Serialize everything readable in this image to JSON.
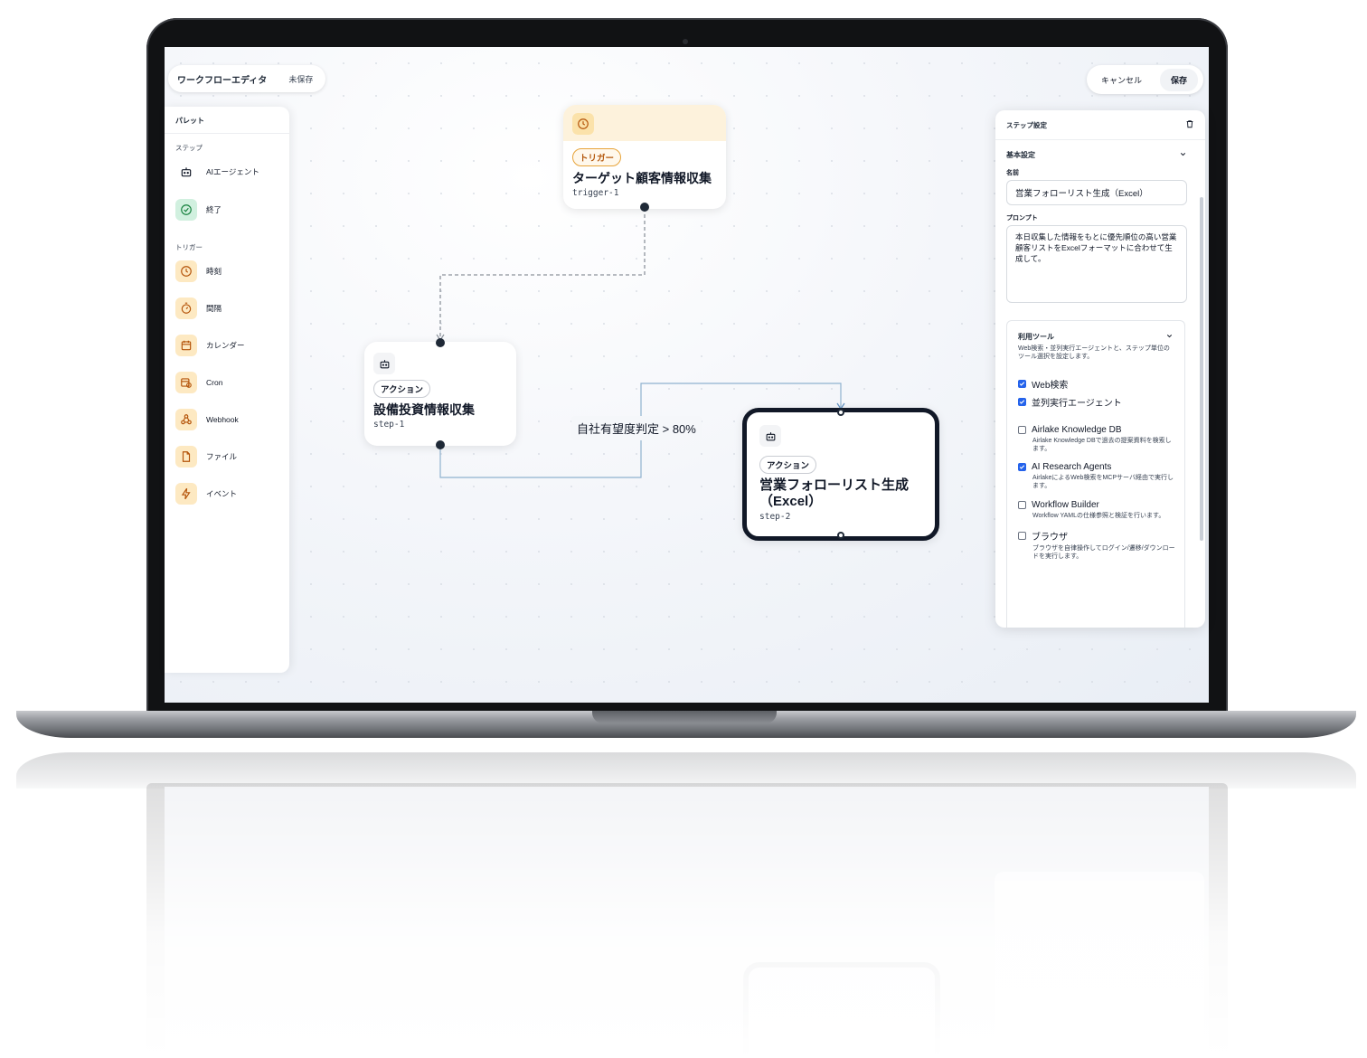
{
  "header": {
    "title": "ワークフローエディタ",
    "status": "未保存",
    "cancel_label": "キャンセル",
    "save_label": "保存"
  },
  "palette": {
    "title": "パレット",
    "steps_label": "ステップ",
    "steps": [
      {
        "label": "AIエージェント",
        "icon": "robot-icon"
      },
      {
        "label": "終了",
        "icon": "check-circle-icon"
      }
    ],
    "triggers_label": "トリガー",
    "triggers": [
      {
        "label": "時刻",
        "icon": "clock-icon"
      },
      {
        "label": "間隔",
        "icon": "timer-icon"
      },
      {
        "label": "カレンダー",
        "icon": "calendar-icon"
      },
      {
        "label": "Cron",
        "icon": "calendar-clock-icon"
      },
      {
        "label": "Webhook",
        "icon": "webhook-icon"
      },
      {
        "label": "ファイル",
        "icon": "file-icon"
      },
      {
        "label": "イベント",
        "icon": "bolt-icon"
      }
    ]
  },
  "nodes": {
    "trigger": {
      "badge": "トリガー",
      "title": "ターゲット顧客情報収集",
      "id": "trigger-1"
    },
    "step1": {
      "badge": "アクション",
      "title": "設備投資情報収集",
      "id": "step-1"
    },
    "step2": {
      "badge": "アクション",
      "title_line1": "営業フォローリスト生成",
      "title_line2": "（Excel）",
      "id": "step-2"
    }
  },
  "edge_label": "自社有望度判定 > 80%",
  "settings": {
    "title": "ステップ設定",
    "basic_label": "基本設定",
    "name_label": "名前",
    "name_value": "営業フォローリスト生成（Excel）",
    "prompt_label": "プロンプト",
    "prompt_value": "本日収集した情報をもとに優先順位の高い営業顧客リストをExcelフォーマットに合わせて生成して。",
    "tools_label": "利用ツール",
    "tools_desc": "Web検索・並列実行エージェントと、ステップ単位のツール選択を設定します。",
    "tools": [
      {
        "label": "Web検索",
        "checked": true,
        "desc": ""
      },
      {
        "label": "並列実行エージェント",
        "checked": true,
        "desc": ""
      },
      {
        "label": "Airlake Knowledge DB",
        "checked": false,
        "desc": "Airlake Knowledge DBで過去の提案資料を検索します。"
      },
      {
        "label": "AI Research Agents",
        "checked": true,
        "desc": "AirlakeによるWeb検索をMCPサーバ経由で実行します。"
      },
      {
        "label": "Workflow Builder",
        "checked": false,
        "desc": "Workflow YAMLの仕様参照と検証を行います。"
      },
      {
        "label": "ブラウザ",
        "checked": false,
        "desc": "ブラウザを自律操作してログイン/遷移/ダウンロードを実行します。"
      }
    ]
  },
  "colors": {
    "trigger_head": "#fdf2dc",
    "trigger_badge": "#b4580d",
    "selected_border": "#111827",
    "checkbox_on": "#2563eb"
  }
}
